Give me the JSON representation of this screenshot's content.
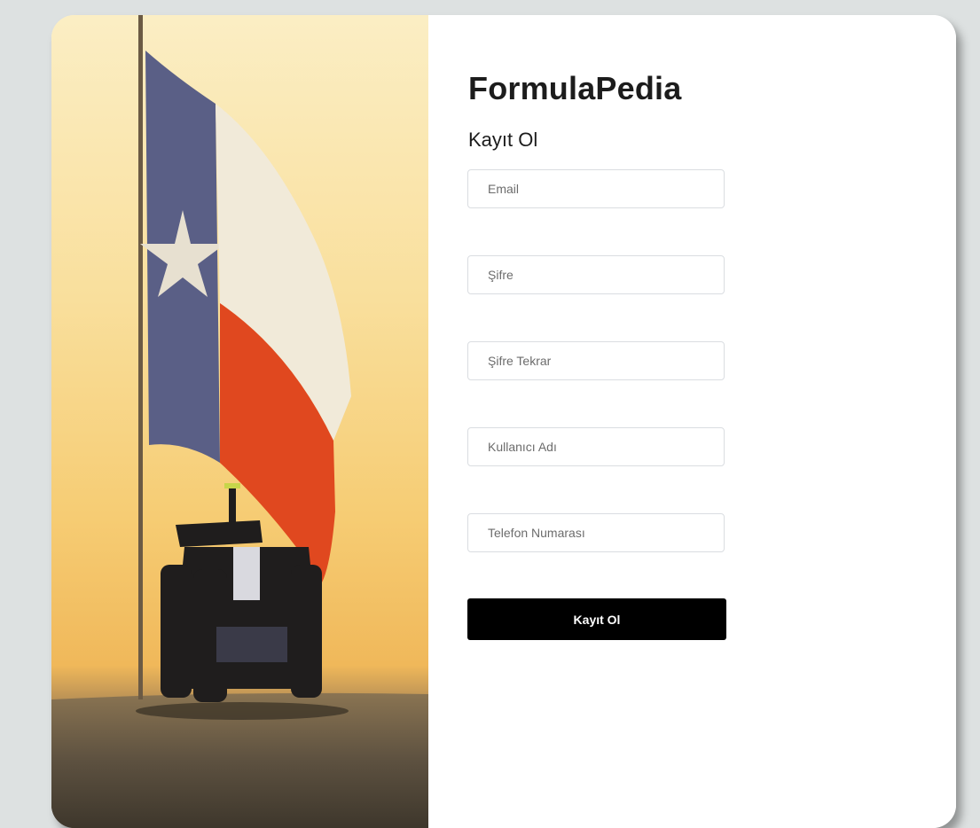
{
  "brand": {
    "title": "FormulaPedia"
  },
  "form": {
    "heading": "Kayıt Ol",
    "fields": [
      {
        "name": "email",
        "placeholder": "Email",
        "value": ""
      },
      {
        "name": "password",
        "placeholder": "Şifre",
        "value": ""
      },
      {
        "name": "password_repeat",
        "placeholder": "Şifre Tekrar",
        "value": ""
      },
      {
        "name": "username",
        "placeholder": "Kullanıcı Adı",
        "value": ""
      },
      {
        "name": "phone",
        "placeholder": "Telefon Numarası",
        "value": ""
      }
    ],
    "submit_label": "Kayıt Ol"
  },
  "hero": {
    "image": "texas-flag-f1-car-photo"
  },
  "colors": {
    "button_bg": "#000000",
    "button_text": "#ffffff",
    "page_bg": "#dde1e1",
    "card_bg": "#ffffff"
  }
}
